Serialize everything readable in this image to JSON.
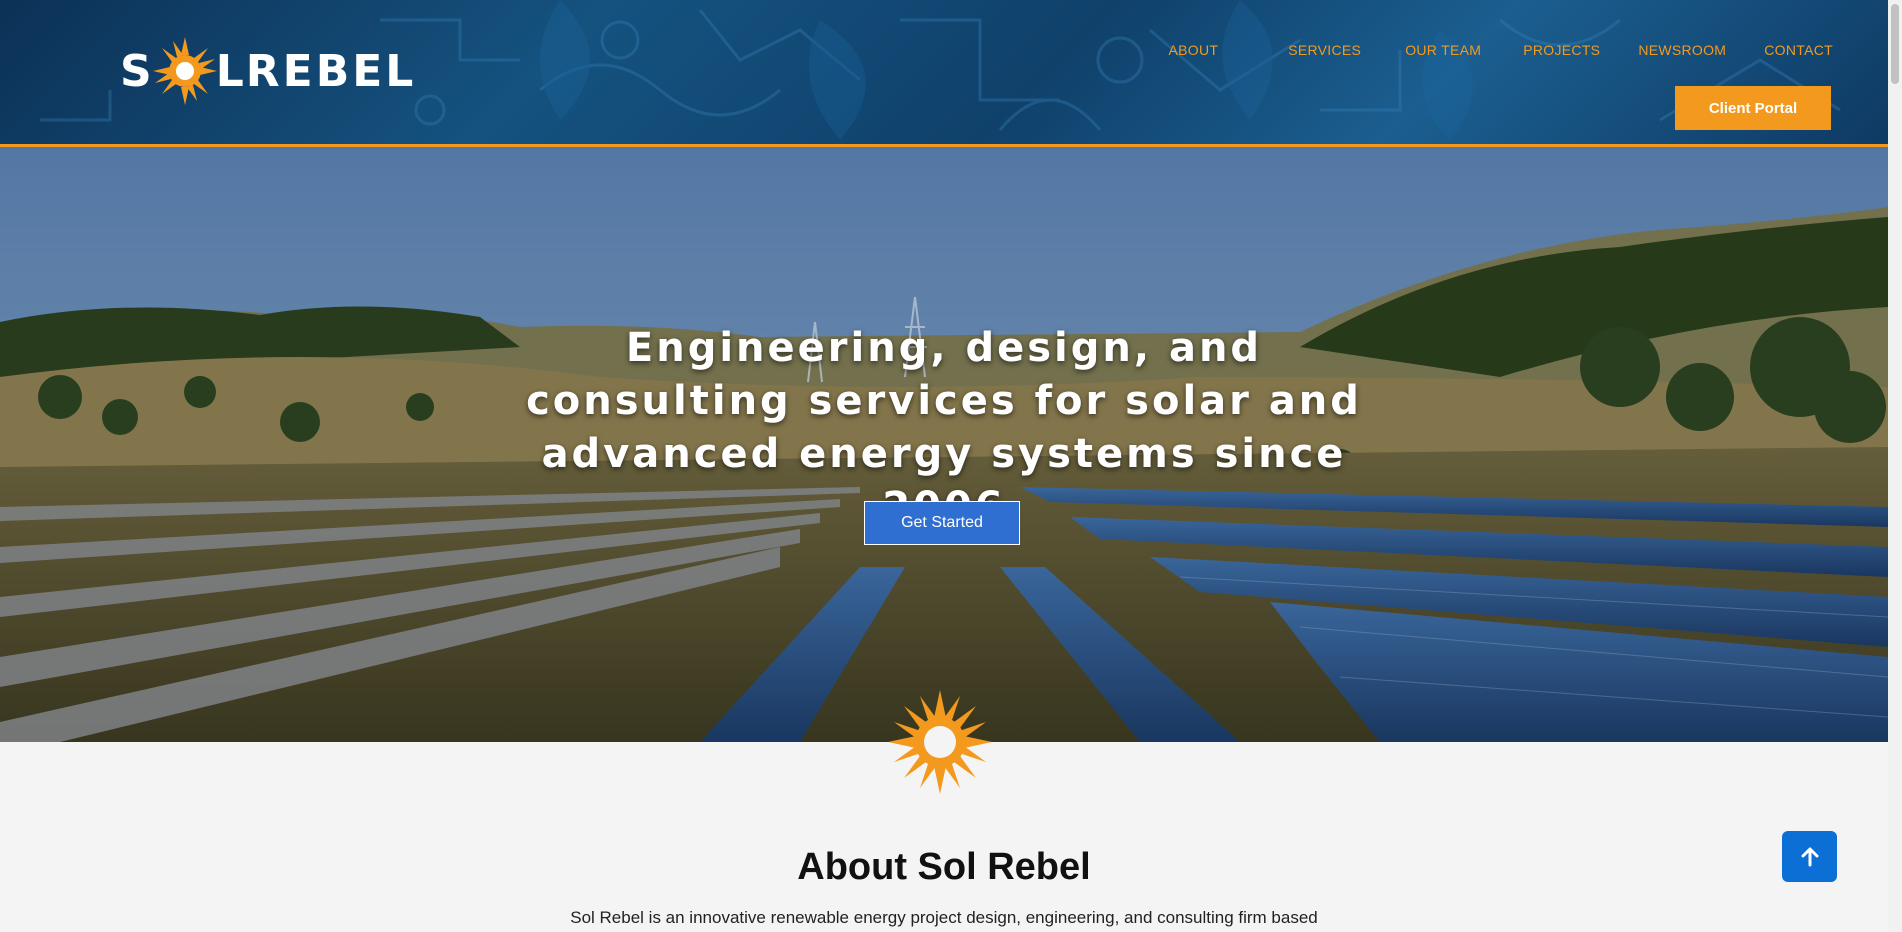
{
  "header": {
    "logo": {
      "first_letter": "S",
      "middle_letter": "L",
      "rest": "REBEL"
    },
    "nav": {
      "about": "ABOUT",
      "services": "SERVICES",
      "team": "OUR TEAM",
      "projects": "PROJECTS",
      "newsroom": "NEWSROOM",
      "contact": "CONTACT"
    },
    "client_portal": "Client Portal"
  },
  "hero": {
    "title": "Engineering, design, and consulting services for solar and advanced energy systems since 2006",
    "cta": "Get Started"
  },
  "about": {
    "title": "About Sol Rebel",
    "text": "Sol Rebel is an innovative renewable energy project design, engineering, and consulting firm based"
  },
  "icons": {
    "logo_sun": "sun-icon",
    "divider_sun": "sun-icon",
    "back_to_top": "arrow-up-icon"
  },
  "colors": {
    "accent": "#f39a1e",
    "header_blue": "#0f416b",
    "cta_blue": "#2f6fd1",
    "back_to_top_blue": "#0c6fd6",
    "page_bg": "#f4f4f4"
  }
}
